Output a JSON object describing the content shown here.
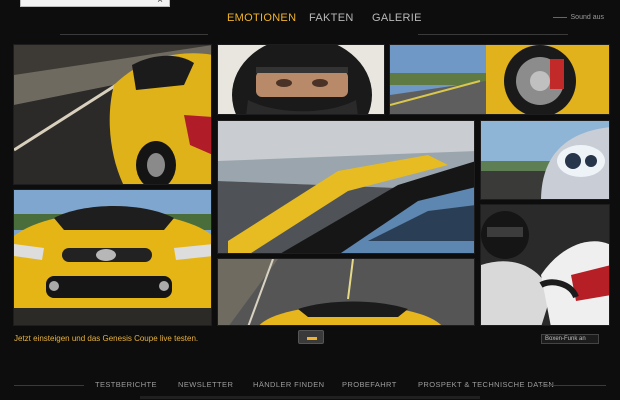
{
  "search": {
    "close_glyph": "×"
  },
  "nav": {
    "items": [
      {
        "label": "EMOTIONEN",
        "active": true
      },
      {
        "label": "FAKTEN",
        "active": false
      },
      {
        "label": "GALERIE",
        "active": false
      }
    ],
    "sound_label": "Sound aus"
  },
  "caption": "Jetzt einsteigen und das Genesis Coupe live testen.",
  "boxen_label": "Boxen-Funk an",
  "footer": {
    "items": [
      "TESTBERICHTE",
      "NEWSLETTER",
      "HÄNDLER FINDEN",
      "PROBEFAHRT",
      "PROSPEKT & TECHNISCHE DATEN"
    ]
  },
  "colors": {
    "accent": "#f0b32b",
    "background": "#0d0d0d"
  }
}
